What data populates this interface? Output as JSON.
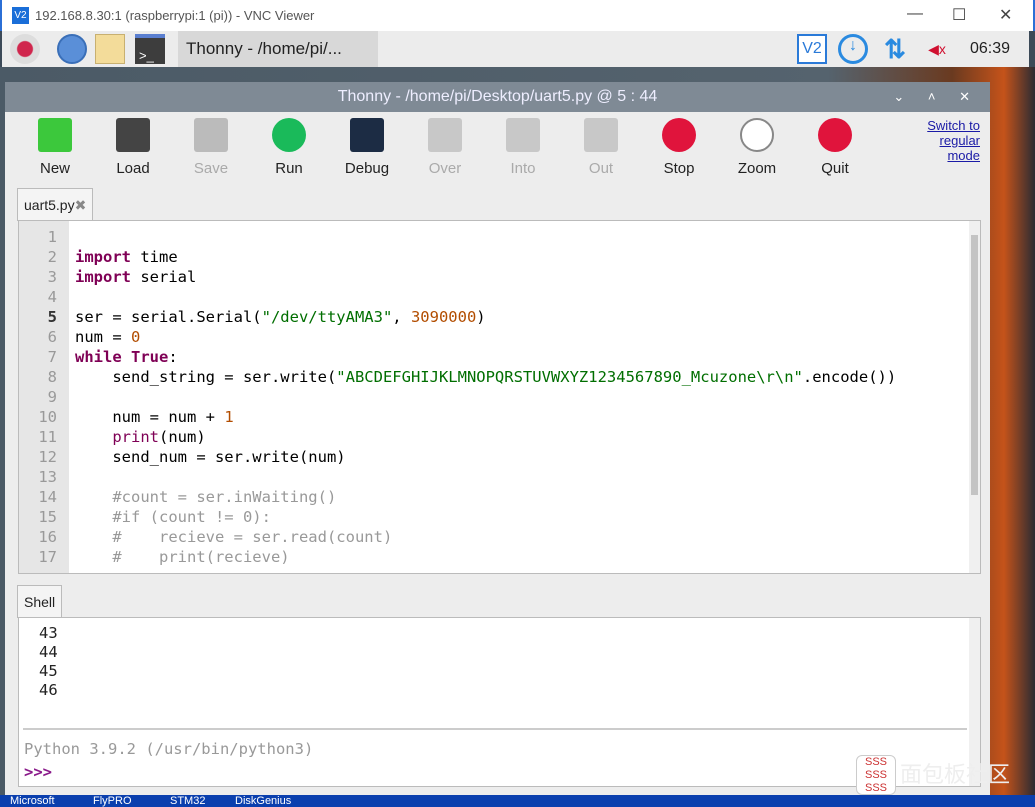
{
  "vnc": {
    "title": "192.168.8.30:1 (raspberrypi:1 (pi)) - VNC Viewer",
    "logo": "V2",
    "min": "—",
    "max": "☐",
    "close": "✕"
  },
  "panel": {
    "task_label": "Thonny  -  /home/pi/...",
    "clock": "06:39",
    "icons": [
      "raspberry-menu-icon",
      "browser-globe-icon",
      "file-manager-icon",
      "terminal-icon",
      "vnc-icon",
      "download-icon",
      "network-arrows-icon",
      "volume-muted-icon"
    ]
  },
  "window": {
    "title": "Thonny  -  /home/pi/Desktop/uart5.py  @  5 : 44",
    "controls": "⌄ ˄ ✕"
  },
  "toolbar": [
    {
      "label": "New",
      "enabled": true,
      "color": "#3cc83c"
    },
    {
      "label": "Load",
      "enabled": true,
      "color": "#444444"
    },
    {
      "label": "Save",
      "enabled": false,
      "color": "#bbbbbb"
    },
    {
      "label": "Run",
      "enabled": true,
      "color": "#1aba5a"
    },
    {
      "label": "Debug",
      "enabled": true,
      "color": "#1c2c44"
    },
    {
      "label": "Over",
      "enabled": false,
      "color": "#c8c8c8"
    },
    {
      "label": "Into",
      "enabled": false,
      "color": "#c8c8c8"
    },
    {
      "label": "Out",
      "enabled": false,
      "color": "#c8c8c8"
    },
    {
      "label": "Stop",
      "enabled": true,
      "color": "#e0143c"
    },
    {
      "label": "Zoom",
      "enabled": true,
      "color": "#ffffff"
    },
    {
      "label": "Quit",
      "enabled": true,
      "color": "#e0143c"
    }
  ],
  "switch_mode": [
    "Switch to",
    "regular",
    "mode"
  ],
  "editor": {
    "tab": "uart5.py",
    "close": "✖",
    "lines": [
      [],
      [
        [
          "import",
          "kw"
        ],
        [
          " time",
          ""
        ]
      ],
      [
        [
          "import",
          "kw"
        ],
        [
          " serial",
          ""
        ]
      ],
      [],
      [
        [
          "ser = serial.Serial(",
          ""
        ],
        [
          "\"/dev/ttyAMA3\"",
          "st"
        ],
        [
          ", ",
          ""
        ],
        [
          "3090000",
          "nm"
        ],
        [
          ")",
          ""
        ]
      ],
      [
        [
          "num = ",
          ""
        ],
        [
          "0",
          "nm"
        ]
      ],
      [
        [
          "while",
          "kw"
        ],
        [
          " ",
          ""
        ],
        [
          "True",
          "kw"
        ],
        [
          ":",
          ""
        ]
      ],
      [
        [
          "    send_string = ser.write(",
          ""
        ],
        [
          "\"ABCDEFGHIJKLMNOPQRSTUVWXYZ1234567890_Mcuzone\\r\\n\"",
          "st"
        ],
        [
          ".encode())",
          ""
        ]
      ],
      [],
      [
        [
          "    num = num + ",
          ""
        ],
        [
          "1",
          "nm"
        ]
      ],
      [
        [
          "    ",
          ""
        ],
        [
          "print",
          "bi"
        ],
        [
          "(num)",
          ""
        ]
      ],
      [
        [
          "    send_num = ser.write(num)",
          ""
        ]
      ],
      [],
      [
        [
          "    #count = ser.inWaiting()",
          "cm"
        ]
      ],
      [
        [
          "    #if (count != 0):",
          "cm"
        ]
      ],
      [
        [
          "    #    recieve = ser.read(count)",
          "cm"
        ]
      ],
      [
        [
          "    #    print(recieve)",
          "cm"
        ]
      ]
    ]
  },
  "shell": {
    "tab": "Shell",
    "output": [
      "43",
      "44",
      "45",
      "46"
    ],
    "banner": "Python 3.9.2 (/usr/bin/python3)",
    "prompt": ">>>"
  },
  "taskbar": [
    "Microsoft",
    "FlyPRO",
    "STM32",
    "DiskGenius"
  ],
  "watermark": "面包板社区"
}
